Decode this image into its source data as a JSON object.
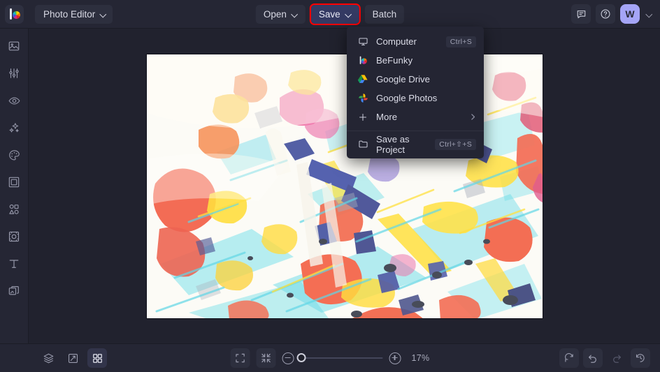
{
  "app": {
    "name": "BeFunky",
    "logo_icon": "befunky-logo-icon",
    "mode_label": "Photo Editor"
  },
  "toolbar": {
    "open_label": "Open",
    "save_label": "Save",
    "batch_label": "Batch",
    "feedback_icon": "comment-icon",
    "help_icon": "question-circle-icon",
    "avatar_initial": "W",
    "account_caret_icon": "chevron-down-icon",
    "save_highlight_color": "#ff0000",
    "save_button_color": "#343a63",
    "avatar_color": "#a5a5f7"
  },
  "save_menu": {
    "visible": true,
    "items": [
      {
        "label": "Computer",
        "icon": "monitor-icon",
        "shortcut": "Ctrl+S",
        "submenu": false
      },
      {
        "label": "BeFunky",
        "icon": "befunky-logo-icon",
        "shortcut": "",
        "submenu": false
      },
      {
        "label": "Google Drive",
        "icon": "google-drive-icon",
        "shortcut": "",
        "submenu": false
      },
      {
        "label": "Google Photos",
        "icon": "google-photos-icon",
        "shortcut": "",
        "submenu": false
      },
      {
        "label": "More",
        "icon": "plus-icon",
        "shortcut": "",
        "submenu": true
      }
    ],
    "project_item": {
      "label": "Save as Project",
      "icon": "folder-icon",
      "shortcut": "Ctrl+⇧+S"
    }
  },
  "sidebar": {
    "items": [
      {
        "label": "Edit",
        "icon": "image-icon"
      },
      {
        "label": "Touch Up",
        "icon": "sliders-icon"
      },
      {
        "label": "Retouch",
        "icon": "eye-icon"
      },
      {
        "label": "Effects",
        "icon": "sparkle-icon"
      },
      {
        "label": "Artsy",
        "icon": "palette-icon"
      },
      {
        "label": "Frames",
        "icon": "frame-icon"
      },
      {
        "label": "Overlays",
        "icon": "shapes-icon"
      },
      {
        "label": "Textures",
        "icon": "texture-icon"
      },
      {
        "label": "Text",
        "icon": "text-icon"
      },
      {
        "label": "Graphics",
        "icon": "graphics-icon"
      }
    ]
  },
  "canvas": {
    "image_description": "Abstract watercolor paint splatter artwork"
  },
  "bottombar": {
    "left_tools": [
      {
        "label": "Layers",
        "icon": "layers-icon",
        "active": false
      },
      {
        "label": "Compare",
        "icon": "compare-icon",
        "active": false
      },
      {
        "label": "Grid View",
        "icon": "grid-icon",
        "active": true
      }
    ],
    "fit_icon": "fit-screen-icon",
    "shrink_icon": "shrink-icon",
    "zoom_out_icon": "zoom-out-icon",
    "zoom_in_icon": "zoom-in-icon",
    "zoom_level": "17%",
    "zoom_slider_value": 0,
    "right_tools": [
      {
        "label": "Reset",
        "icon": "reset-icon",
        "disabled": false
      },
      {
        "label": "Undo",
        "icon": "undo-icon",
        "disabled": false
      },
      {
        "label": "Redo",
        "icon": "redo-icon",
        "disabled": true
      },
      {
        "label": "History",
        "icon": "history-icon",
        "disabled": false
      }
    ]
  }
}
